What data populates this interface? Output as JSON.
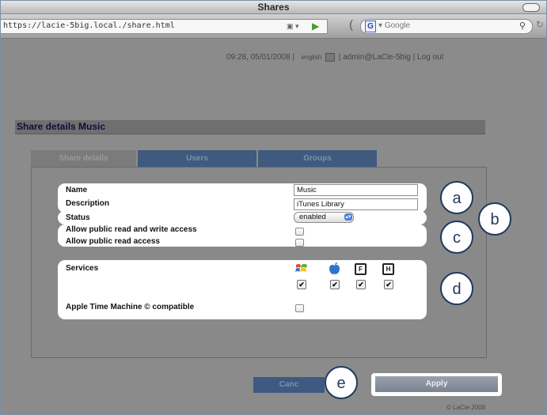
{
  "window": {
    "title": "Shares"
  },
  "toolbar": {
    "url": "https://lacie-5big.local./share.html",
    "search_placeholder": "Google"
  },
  "topline": {
    "datetime": "09:28, 05/01/2008 |",
    "language": "english",
    "user": "| admin@LaCie-5big |",
    "logout": "Log out"
  },
  "share": {
    "header": "Share details Music"
  },
  "tabs": [
    "Share details",
    "Users",
    "Groups"
  ],
  "form": {
    "name_label": "Name",
    "name_value": "Music",
    "description_label": "Description",
    "description_value": "iTunes Library",
    "status_label": "Status",
    "status_value": "enabled",
    "rw_label": "Allow public read and write access",
    "read_label": "Allow public read access",
    "services_label": "Services",
    "timemachine_label": "Apple Time Machine © compatible"
  },
  "services": [
    {
      "icon": "windows-icon",
      "checked": true
    },
    {
      "icon": "apple-icon",
      "checked": true
    },
    {
      "icon": "ftp-icon",
      "glyph": "F",
      "checked": true
    },
    {
      "icon": "http-icon",
      "glyph": "H",
      "checked": true
    }
  ],
  "callouts": {
    "a": "a",
    "b": "b",
    "c": "c",
    "d": "d",
    "e": "e"
  },
  "buttons": {
    "cancel": "Canc",
    "apply": "Apply"
  },
  "footer": "© LaCie 2008",
  "colors": {
    "callout_border": "#21395f",
    "tab_inactive": "#3f5a7e",
    "apply": "#8a909c"
  }
}
